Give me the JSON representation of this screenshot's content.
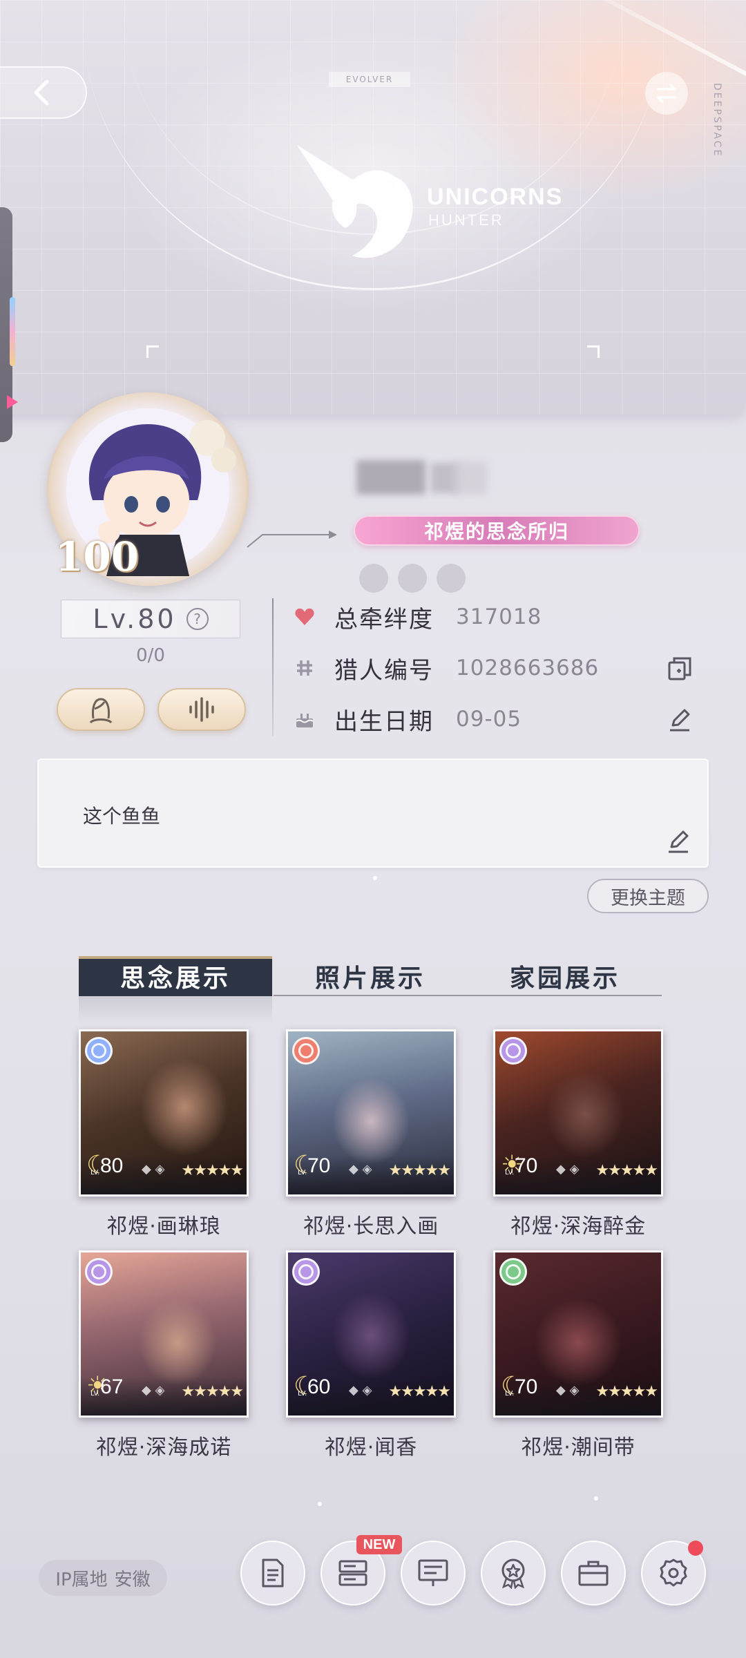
{
  "header": {
    "evolver_label": "EVOLVER",
    "side_text": "DEEPSPACE",
    "logo_title": "UNICORNS",
    "logo_subtitle": "HUNTER"
  },
  "profile": {
    "avatar_level": "100",
    "title_badge": "祁煜的思念所归",
    "level": "Lv.80",
    "exp": "0/0"
  },
  "stats": [
    {
      "icon": "heart-icon",
      "label": "总牵绊度",
      "value": "317018"
    },
    {
      "icon": "hash-icon",
      "label": "猎人编号",
      "value": "1028663686",
      "action": "copy-icon"
    },
    {
      "icon": "cake-icon",
      "label": "出生日期",
      "value": "09-05",
      "action": "edit-icon"
    }
  ],
  "signature": {
    "text": "这个鱼鱼"
  },
  "theme_button": "更换主题",
  "tabs": [
    {
      "label": "思念展示",
      "active": true
    },
    {
      "label": "照片展示",
      "active": false
    },
    {
      "label": "家园展示",
      "active": false
    }
  ],
  "cards": [
    {
      "name": "祁煜·画琳琅",
      "level": "80",
      "lv_tag": "LV.",
      "phase": "moon",
      "gem_color": "#8fb0ff",
      "stars": "★★★★★"
    },
    {
      "name": "祁煜·长思入画",
      "level": "70",
      "lv_tag": "LV.",
      "phase": "moon",
      "gem_color": "#ee7f6f",
      "stars": "★★★★★"
    },
    {
      "name": "祁煜·深海醉金",
      "level": "70",
      "lv_tag": "LV.",
      "phase": "sun",
      "gem_color": "#b796e8",
      "stars": "★★★★★"
    },
    {
      "name": "祁煜·深海成诺",
      "level": "67",
      "lv_tag": "LV.",
      "phase": "sun",
      "gem_color": "#b796e8",
      "stars": "★★★★★"
    },
    {
      "name": "祁煜·闻香",
      "level": "60",
      "lv_tag": "LV.",
      "phase": "moon",
      "gem_color": "#b796e8",
      "stars": "★★★★★"
    },
    {
      "name": "祁煜·潮间带",
      "level": "70",
      "lv_tag": "LV.",
      "phase": "moon",
      "gem_color": "#7cc98a",
      "stars": "★★★★★"
    }
  ],
  "footer": {
    "ip_label": "IP属地",
    "ip_region": "安徽",
    "new_badge": "NEW",
    "nav_icons": [
      "document-icon",
      "list-icon",
      "message-board-icon",
      "achievement-icon",
      "briefcase-icon",
      "settings-icon"
    ]
  }
}
